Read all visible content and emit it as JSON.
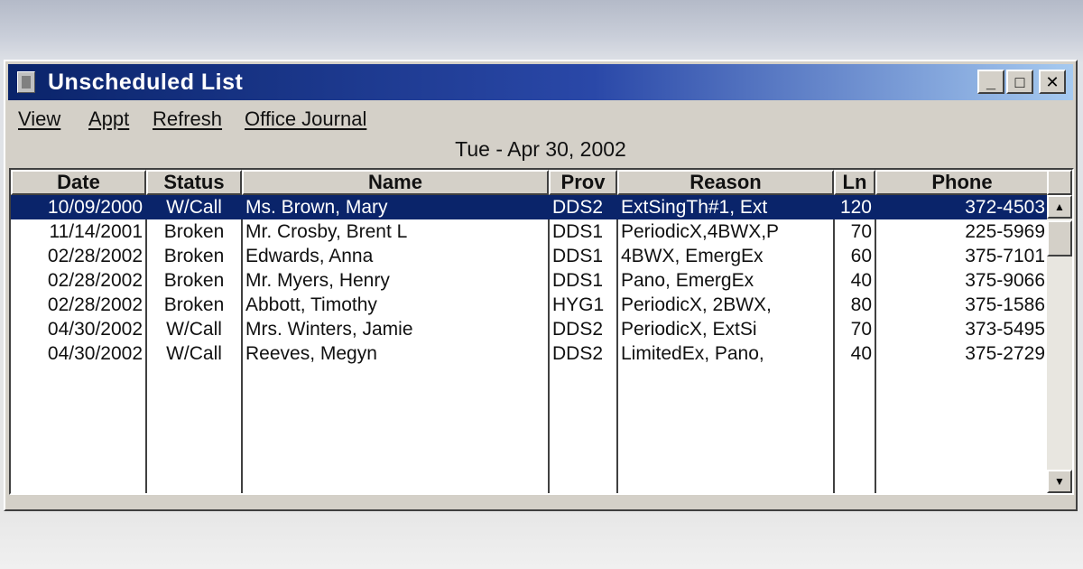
{
  "window": {
    "title": "Unscheduled List",
    "minimize_glyph": "_",
    "maximize_glyph": "□",
    "close_glyph": "✕"
  },
  "menu": {
    "items": [
      {
        "label": "View"
      },
      {
        "label": "Appt"
      },
      {
        "label": "Refresh"
      },
      {
        "label": "Office Journal"
      }
    ]
  },
  "date_banner": "Tue - Apr 30, 2002",
  "table": {
    "columns": [
      "Date",
      "Status",
      "Name",
      "Prov",
      "Reason",
      "Ln",
      "Phone"
    ],
    "rows": [
      {
        "date": "10/09/2000",
        "status": "W/Call",
        "name": "Ms. Brown, Mary",
        "prov": "DDS2",
        "reason": "ExtSingTh#1, Ext",
        "ln": "120",
        "phone": "372-4503",
        "selected": true
      },
      {
        "date": "11/14/2001",
        "status": "Broken",
        "name": "Mr. Crosby, Brent L",
        "prov": "DDS1",
        "reason": "PeriodicX,4BWX,P",
        "ln": "70",
        "phone": "225-5969",
        "selected": false
      },
      {
        "date": "02/28/2002",
        "status": "Broken",
        "name": "Edwards, Anna",
        "prov": "DDS1",
        "reason": "4BWX, EmergEx",
        "ln": "60",
        "phone": "375-7101",
        "selected": false
      },
      {
        "date": "02/28/2002",
        "status": "Broken",
        "name": "Mr. Myers, Henry",
        "prov": "DDS1",
        "reason": "Pano, EmergEx",
        "ln": "40",
        "phone": "375-9066",
        "selected": false
      },
      {
        "date": "02/28/2002",
        "status": "Broken",
        "name": "Abbott, Timothy",
        "prov": "HYG1",
        "reason": "PeriodicX, 2BWX,",
        "ln": "80",
        "phone": "375-1586",
        "selected": false
      },
      {
        "date": "04/30/2002",
        "status": "W/Call",
        "name": "Mrs. Winters, Jamie",
        "prov": "DDS2",
        "reason": "PeriodicX, ExtSi",
        "ln": "70",
        "phone": "373-5495",
        "selected": false
      },
      {
        "date": "04/30/2002",
        "status": "W/Call",
        "name": "Reeves, Megyn",
        "prov": "DDS2",
        "reason": "LimitedEx, Pano,",
        "ln": "40",
        "phone": "375-2729",
        "selected": false
      }
    ]
  },
  "scrollbar": {
    "up_glyph": "▲",
    "down_glyph": "▼"
  }
}
